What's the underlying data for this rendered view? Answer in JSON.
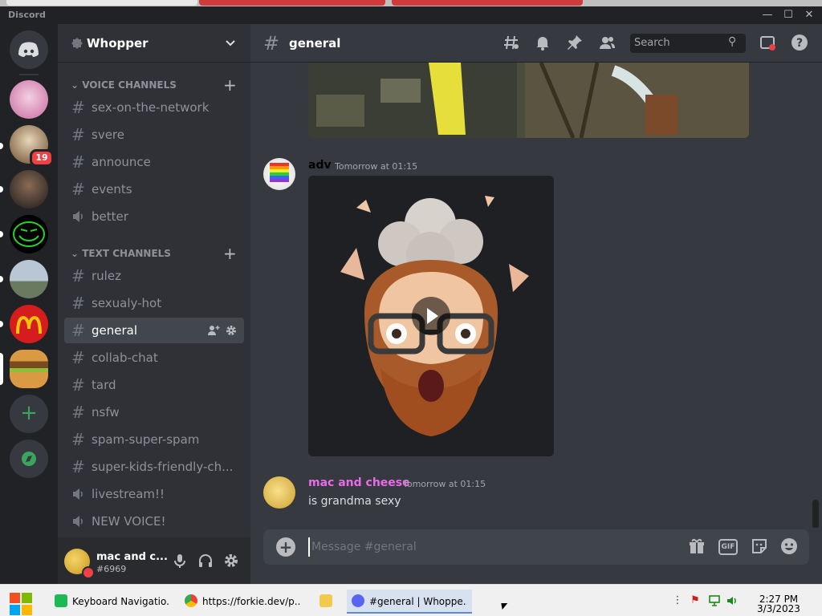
{
  "window": {
    "brand": "Discord",
    "controls": [
      "minimize-icon",
      "maximize-icon",
      "close-icon"
    ]
  },
  "servers": [
    {
      "name": "home",
      "color": "#5865f2",
      "glyph": "discord-icon"
    },
    {
      "name": "server-1",
      "color": "#e9a6c6"
    },
    {
      "name": "server-2",
      "color": "#6b4b2d",
      "badge": "19"
    },
    {
      "name": "server-3",
      "color": "#2b2b2b"
    },
    {
      "name": "server-4",
      "color": "#1a1a1a"
    },
    {
      "name": "server-5",
      "color": "#7a8ca0"
    },
    {
      "name": "server-6",
      "color": "#d61d1d"
    },
    {
      "name": "server-7",
      "color": "#c98a3a"
    }
  ],
  "server": {
    "name": "Whopper",
    "chevron": "chevron-down-icon"
  },
  "sections": {
    "voice": "VOICE CHANNELS",
    "text": "TEXT CHANNELS"
  },
  "voice_channels": [
    {
      "name": "sex-on-the-network",
      "type": "text"
    },
    {
      "name": "svere",
      "type": "text"
    },
    {
      "name": "announce",
      "type": "text"
    },
    {
      "name": "events",
      "type": "text"
    },
    {
      "name": "better",
      "type": "voice"
    }
  ],
  "text_channels": [
    {
      "name": "rulez",
      "type": "text"
    },
    {
      "name": "sexualy-hot",
      "type": "text"
    },
    {
      "name": "general",
      "type": "text",
      "active": true
    },
    {
      "name": "collab-chat",
      "type": "text"
    },
    {
      "name": "tard",
      "type": "text"
    },
    {
      "name": "nsfw",
      "type": "text"
    },
    {
      "name": "spam-super-spam",
      "type": "text"
    },
    {
      "name": "super-kids-friendly-ch...",
      "type": "text"
    },
    {
      "name": "livestream!!",
      "type": "voice"
    },
    {
      "name": "NEW VOICE!",
      "type": "voice"
    }
  ],
  "user": {
    "name": "mac and c...",
    "tag": "#6969"
  },
  "channel": {
    "name": "general"
  },
  "search": {
    "placeholder": "Search"
  },
  "messages": [
    {
      "author": "adv",
      "author_color": "#ffffff",
      "timestamp": "Tomorrow at 01:15",
      "attachment": "video"
    },
    {
      "author": "mac and cheese",
      "author_color": "#e86be8",
      "timestamp": "Tomorrow at 01:15",
      "text": "is grandma sexy"
    }
  ],
  "composer": {
    "placeholder": "Message #general"
  },
  "taskbar": {
    "items": [
      {
        "label": "Keyboard Navigatio...",
        "icon_color": "#1db954"
      },
      {
        "label": "https://forkie.dev/p...",
        "icon_color": "#4285f4"
      },
      {
        "label": "",
        "icon_color": "#f2c94c"
      },
      {
        "label": "#general | Whoppe...",
        "icon_color": "#5865f2",
        "active": true
      }
    ],
    "time": "2:27 PM",
    "date": "3/3/2023"
  }
}
